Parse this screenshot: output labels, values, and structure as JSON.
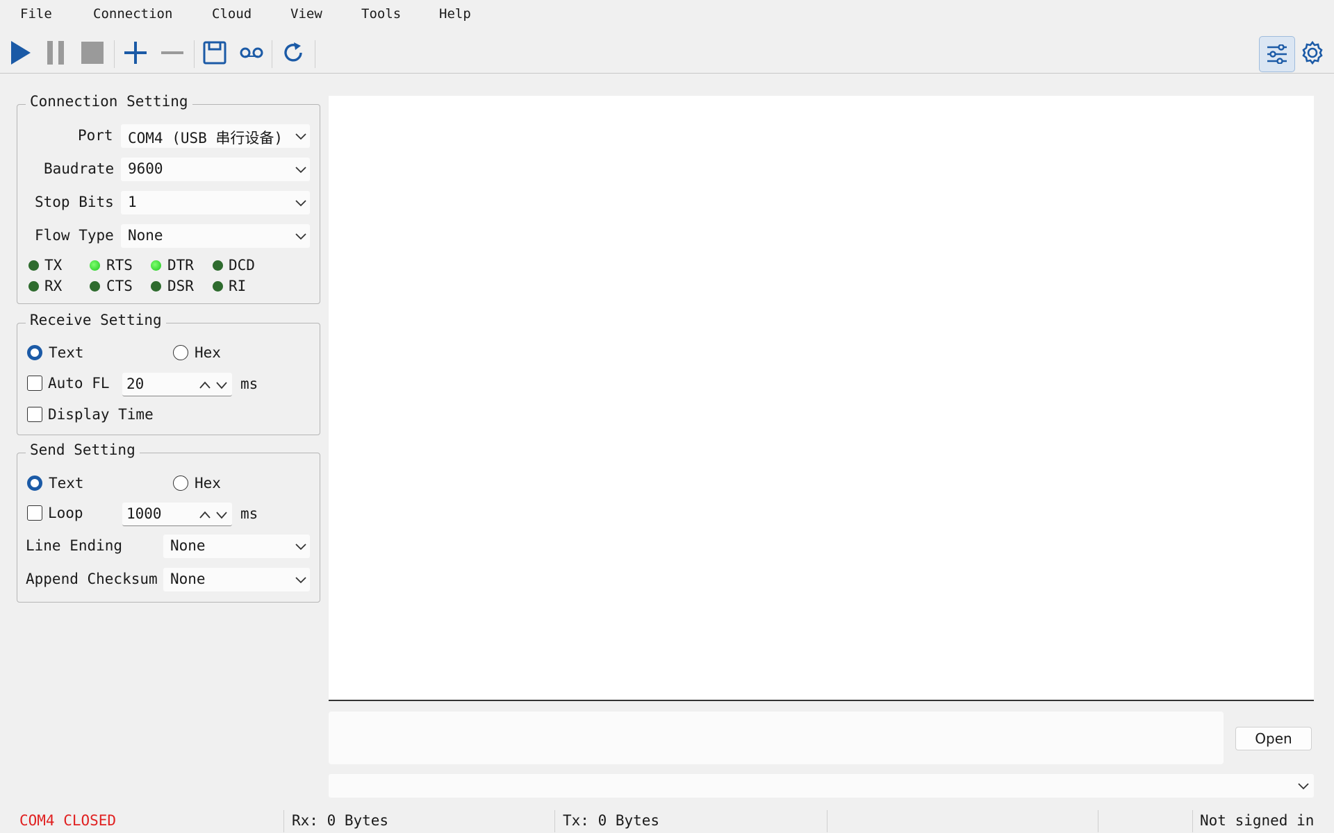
{
  "menu": [
    "File",
    "Connection",
    "Cloud",
    "View",
    "Tools",
    "Help"
  ],
  "toolbar": {
    "buttons": [
      "play-icon",
      "pause-icon",
      "stop-icon",
      "plus-icon",
      "minus-icon",
      "save-icon",
      "record-icon",
      "refresh-icon",
      "settings-panel-icon",
      "gear-icon"
    ],
    "accent": "#1b5aa6"
  },
  "connection": {
    "title": "Connection Setting",
    "port_label": "Port",
    "port_value": "COM4 (USB 串行设备)",
    "baudrate_label": "Baudrate",
    "baudrate_value": "9600",
    "stopbits_label": "Stop Bits",
    "stopbits_value": "1",
    "flowtype_label": "Flow Type",
    "flowtype_value": "None",
    "signals": [
      {
        "name": "TX",
        "on": false
      },
      {
        "name": "RTS",
        "on": true
      },
      {
        "name": "DTR",
        "on": true
      },
      {
        "name": "DCD",
        "on": false
      },
      {
        "name": "RX",
        "on": false
      },
      {
        "name": "CTS",
        "on": false
      },
      {
        "name": "DSR",
        "on": false
      },
      {
        "name": "RI",
        "on": false
      }
    ]
  },
  "receive": {
    "title": "Receive Setting",
    "text_label": "Text",
    "hex_label": "Hex",
    "autofl_label": "Auto FL",
    "autofl_value": "20",
    "ms": "ms",
    "display_time_label": "Display Time"
  },
  "send": {
    "title": "Send Setting",
    "text_label": "Text",
    "hex_label": "Hex",
    "loop_label": "Loop",
    "loop_value": "1000",
    "ms": "ms",
    "line_ending_label": "Line Ending",
    "line_ending_value": "None",
    "checksum_label": "Append Checksum",
    "checksum_value": "None"
  },
  "open_button": "Open",
  "status": {
    "port_state": "COM4 CLOSED",
    "port_state_color": "#e02020",
    "rx": "Rx: 0 Bytes",
    "tx": "Tx: 0 Bytes",
    "account": "Not signed in"
  }
}
